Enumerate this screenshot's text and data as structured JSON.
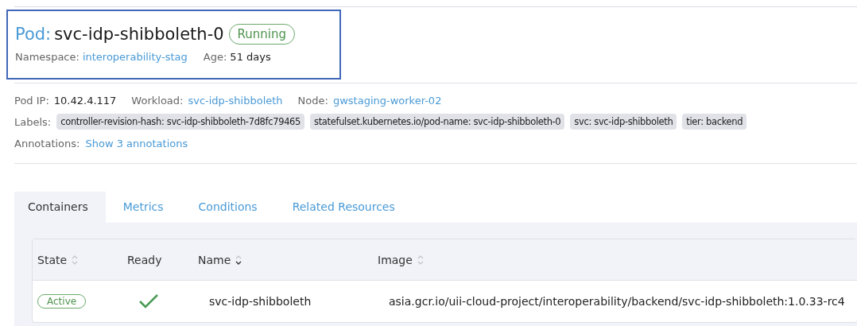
{
  "header": {
    "kind_label": "Pod:",
    "name": "svc-idp-shibboleth-0",
    "status": "Running",
    "highlighted": true,
    "meta": [
      {
        "label": "Namespace:",
        "value": "interoperability-stag",
        "link": true
      },
      {
        "label": "Age:",
        "value": "51 days",
        "link": false
      }
    ]
  },
  "details": {
    "fields": [
      {
        "label": "Pod IP:",
        "value": "10.42.4.117",
        "link": false
      },
      {
        "label": "Workload:",
        "value": "svc-idp-shibboleth",
        "link": true
      },
      {
        "label": "Node:",
        "value": "gwstaging-worker-02",
        "link": true
      }
    ],
    "labels_title": "Labels:",
    "labels": [
      "controller-revision-hash: svc-idp-shibboleth-7d8fc79465",
      "statefulset.kubernetes.io/pod-name: svc-idp-shibboleth-0",
      "svc: svc-idp-shibboleth",
      "tier: backend"
    ],
    "annotations_title": "Annotations:",
    "annotations_link": "Show 3 annotations"
  },
  "tabs": [
    {
      "label": "Containers",
      "selected": true
    },
    {
      "label": "Metrics",
      "selected": false
    },
    {
      "label": "Conditions",
      "selected": false
    },
    {
      "label": "Related Resources",
      "selected": false
    }
  ],
  "table": {
    "columns": [
      {
        "label": "State",
        "kind": "sortable"
      },
      {
        "label": "Ready",
        "kind": "plain"
      },
      {
        "label": "Name",
        "kind": "sorted"
      },
      {
        "label": "Image",
        "kind": "sortable"
      }
    ],
    "rows": [
      {
        "state": "Active",
        "ready": true,
        "name": "svc-idp-shibboleth",
        "image": "asia.gcr.io/uii-cloud-project/interoperability/backend/svc-idp-shibboleth:1.0.33-rc4"
      }
    ]
  }
}
